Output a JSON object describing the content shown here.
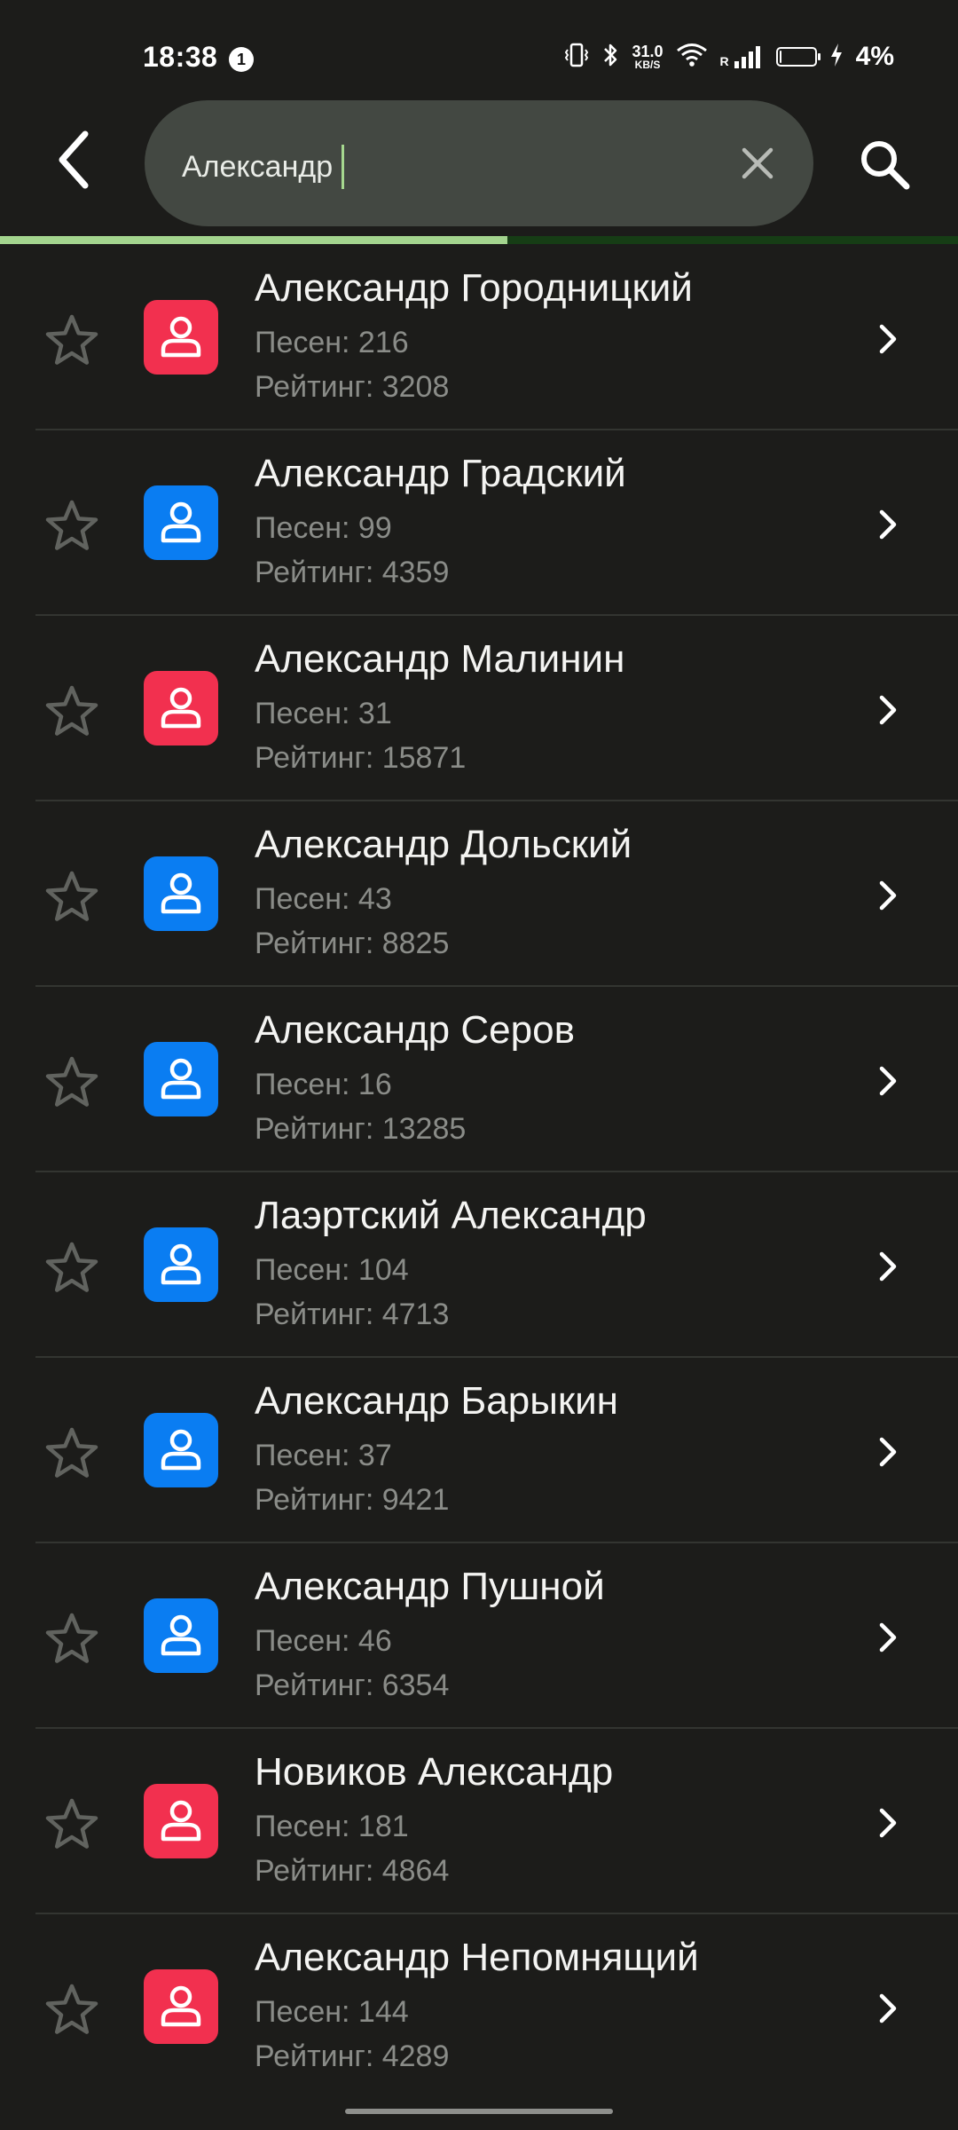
{
  "status_bar": {
    "time": "18:38",
    "notification_count": "1",
    "net_speed_value": "31.0",
    "net_speed_unit": "KB/S",
    "roaming_label": "R",
    "battery_percent": "4%",
    "battery_level": 0.04
  },
  "search": {
    "query": "Александр",
    "progress_fraction": 0.53
  },
  "list_labels": {
    "songs_prefix": "Песен: ",
    "rating_prefix": "Рейтинг: "
  },
  "colors": {
    "avatar_red": "#f2304f",
    "avatar_blue": "#0a7df2",
    "accent_green": "#a3d48e"
  },
  "artists": [
    {
      "name": "Александр Городницкий",
      "songs": "216",
      "rating": "3208",
      "avatar_color": "red"
    },
    {
      "name": "Александр Градский",
      "songs": "99",
      "rating": "4359",
      "avatar_color": "blue"
    },
    {
      "name": "Александр Малинин",
      "songs": "31",
      "rating": "15871",
      "avatar_color": "red"
    },
    {
      "name": "Александр Дольский",
      "songs": "43",
      "rating": "8825",
      "avatar_color": "blue"
    },
    {
      "name": "Александр Серов",
      "songs": "16",
      "rating": "13285",
      "avatar_color": "blue"
    },
    {
      "name": "Лаэртский Александр",
      "songs": "104",
      "rating": "4713",
      "avatar_color": "blue"
    },
    {
      "name": "Александр Барыкин",
      "songs": "37",
      "rating": "9421",
      "avatar_color": "blue"
    },
    {
      "name": "Александр Пушной",
      "songs": "46",
      "rating": "6354",
      "avatar_color": "blue"
    },
    {
      "name": "Новиков Александр",
      "songs": "181",
      "rating": "4864",
      "avatar_color": "red"
    },
    {
      "name": "Александр Непомнящий",
      "songs": "144",
      "rating": "4289",
      "avatar_color": "red"
    }
  ]
}
